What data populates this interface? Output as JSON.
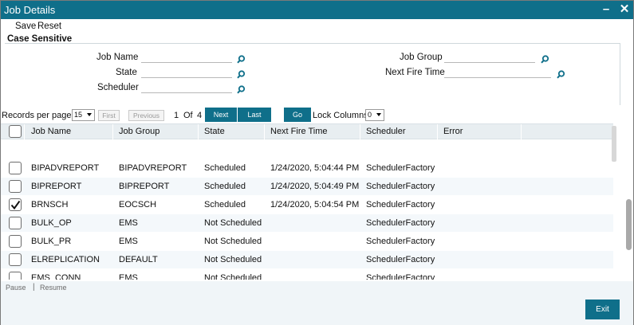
{
  "window": {
    "title": "Job Details",
    "minimize": "–",
    "close": "✕"
  },
  "menu": {
    "save": "Save",
    "reset": "Reset"
  },
  "criteria": {
    "section_label": "Case Sensitive",
    "job_name_label": "Job Name",
    "state_label": "State",
    "scheduler_label": "Scheduler",
    "job_group_label": "Job Group",
    "next_fire_time_label": "Next Fire Time",
    "job_name_value": "",
    "state_value": "",
    "scheduler_value": "",
    "job_group_value": "",
    "next_fire_time_value": ""
  },
  "pager": {
    "records_per_page_label": "Records per page",
    "records_per_page_value": "15",
    "first": "First",
    "previous": "Previous",
    "current_page": "1",
    "of": "Of",
    "total_pages": "4",
    "next": "Next",
    "last": "Last",
    "go": "Go",
    "lock_columns_label": "Lock Columns",
    "lock_columns_value": "0"
  },
  "grid": {
    "columns": [
      "Job Name",
      "Job Group",
      "State",
      "Next Fire Time",
      "Scheduler",
      "Error"
    ],
    "rows": [
      {
        "job_name": "BIPADVREPORT",
        "job_group": "BIPADVREPORT",
        "state": "Scheduled",
        "next_fire_time": "1/24/2020, 5:04:44 PM",
        "scheduler": "SchedulerFactory",
        "error": "",
        "checked": false
      },
      {
        "job_name": "BIPREPORT",
        "job_group": "BIPREPORT",
        "state": "Scheduled",
        "next_fire_time": "1/24/2020, 5:04:49 PM",
        "scheduler": "SchedulerFactory",
        "error": "",
        "checked": false
      },
      {
        "job_name": "BRNSCH",
        "job_group": "EOCSCH",
        "state": "Scheduled",
        "next_fire_time": "1/24/2020, 5:04:54 PM",
        "scheduler": "SchedulerFactory",
        "error": "",
        "checked": true
      },
      {
        "job_name": "BULK_OP",
        "job_group": "EMS",
        "state": "Not Scheduled",
        "next_fire_time": "",
        "scheduler": "SchedulerFactory",
        "error": "",
        "checked": false
      },
      {
        "job_name": "BULK_PR",
        "job_group": "EMS",
        "state": "Not Scheduled",
        "next_fire_time": "",
        "scheduler": "SchedulerFactory",
        "error": "",
        "checked": false
      },
      {
        "job_name": "ELREPLICATION",
        "job_group": "DEFAULT",
        "state": "Not Scheduled",
        "next_fire_time": "",
        "scheduler": "SchedulerFactory",
        "error": "",
        "checked": false
      },
      {
        "job_name": "EMS_CONN",
        "job_group": "EMS",
        "state": "Not Scheduled",
        "next_fire_time": "",
        "scheduler": "SchedulerFactory",
        "error": "",
        "checked": false
      }
    ]
  },
  "footer": {
    "pause": "Pause",
    "separator": "|",
    "resume": "Resume",
    "exit": "Exit"
  },
  "colors": {
    "accent": "#0f6f8a",
    "header_bg": "#e8eef1",
    "footer_bg": "#f0f5f8",
    "alt_row": "#f4f8fb"
  }
}
